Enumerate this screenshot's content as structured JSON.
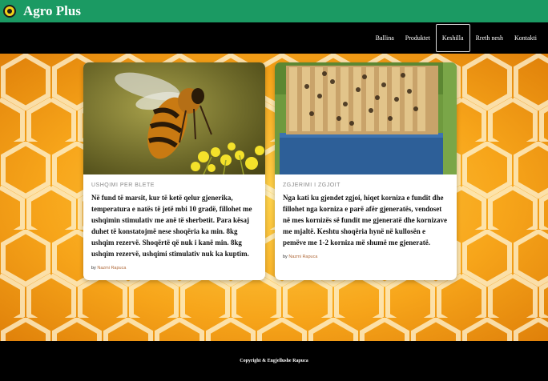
{
  "brand": {
    "name": "Agro Plus",
    "logo_icon": "sunflower-logo-icon",
    "color": "#1b9a63"
  },
  "nav": {
    "items": [
      {
        "label": "Ballina",
        "active": false
      },
      {
        "label": "Produktet",
        "active": false
      },
      {
        "label": "Keshilla",
        "active": true
      },
      {
        "label": "Rreth nesh",
        "active": false
      },
      {
        "label": "Kontakti",
        "active": false
      }
    ]
  },
  "cards": [
    {
      "category": "USHQIMI PER BLETE",
      "text": "Në fund të marsit, kur të ketë qelur gjenerika, temperatura e natës të jetë mbi 10 gradë, fillohet me ushqimin stimulativ me anë të sherbetit. Para kësaj duhet të konstatojmë nese shoqëria ka min. 8kg ushqim rezervë. Shoqërtë që nuk i kanë min. 8kg ushqim rezervë, ushqimi stimulativ nuk ka kuptim.",
      "by": "by",
      "author": "Nazmi Rapuca",
      "image": "bee-on-flower-photo"
    },
    {
      "category": "ZGJERIMI I ZGJOIT",
      "text": "Nga kati ku gjendet zgjoi, hiqet korniza e fundit dhe fillohet nga korniza e parë afër gjeneratës, vendoset në mes kornizës së fundit me gjeneratë dhe kornizave me mjaltë. Keshtu shoqëria hynë në kullosën e pemëve me 1-2 korniza më shumë me gjeneratë.",
      "by": "by",
      "author": "Nazmi Rapuca",
      "image": "open-beehive-photo"
    }
  ],
  "footer": {
    "text": "Copyright & Engjellushe Rapuca"
  }
}
